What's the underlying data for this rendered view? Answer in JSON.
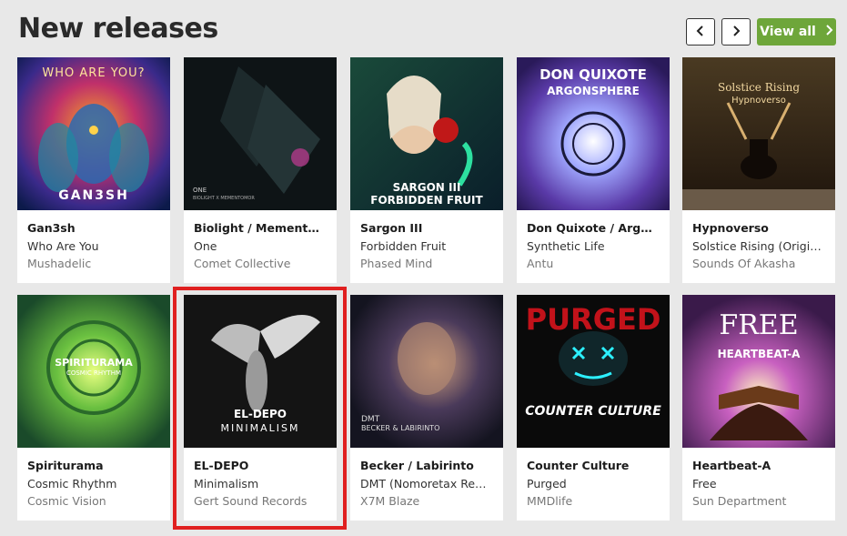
{
  "section": {
    "title": "New releases",
    "view_all_label": "View all"
  },
  "releases": [
    {
      "artist": "Gan3sh",
      "title": "Who Are You",
      "label": "Mushadelic",
      "art_text": "WHO ARE YOU?",
      "art_text2": "GAN3SH"
    },
    {
      "artist": "Biolight / Mementomor",
      "title": "One",
      "label": "Comet Collective",
      "art_text": "ONE",
      "art_text2": "BIOLIGHT X MEMENTOMOR"
    },
    {
      "artist": "Sargon III",
      "title": "Forbidden Fruit",
      "label": "Phased Mind",
      "art_text": "SARGON III",
      "art_text2": "FORBIDDEN FRUIT"
    },
    {
      "artist": "Don Quixote / Argon S…",
      "title": "Synthetic Life",
      "label": "Antu",
      "art_text": "DON QUIXOTE",
      "art_text2": "ARGONSPHERE"
    },
    {
      "artist": "Hypnoverso",
      "title": "Solstice Rising (Origina…",
      "label": "Sounds Of Akasha",
      "art_text": "Solstice Rising",
      "art_text2": "Hypnoverso"
    },
    {
      "artist": "Spiriturama",
      "title": "Cosmic Rhythm",
      "label": "Cosmic Vision",
      "art_text": "SPIRITURAMA",
      "art_text2": "COSMIC RHYTHM"
    },
    {
      "artist": "EL-DEPO",
      "title": "Minimalism",
      "label": "Gert Sound Records",
      "art_text": "EL-DEPO",
      "art_text2": "MINIMALISM"
    },
    {
      "artist": "Becker / Labirinto",
      "title": "DMT (Nomoretax Remix)",
      "label": "X7M Blaze",
      "art_text": "DMT",
      "art_text2": "BECKER & LABIRINTO"
    },
    {
      "artist": "Counter Culture",
      "title": "Purged",
      "label": "MMDlife",
      "art_text": "PURGED",
      "art_text2": "COUNTER CULTURE"
    },
    {
      "artist": "Heartbeat-A",
      "title": "Free",
      "label": "Sun Department",
      "art_text": "FREE",
      "art_text2": "HEARTBEAT-A"
    }
  ],
  "colors": {
    "accent": "#6ea63a",
    "highlight": "#e02020",
    "background": "#e8e8e8"
  },
  "icons": [
    "chevron-left-icon",
    "chevron-right-icon"
  ]
}
